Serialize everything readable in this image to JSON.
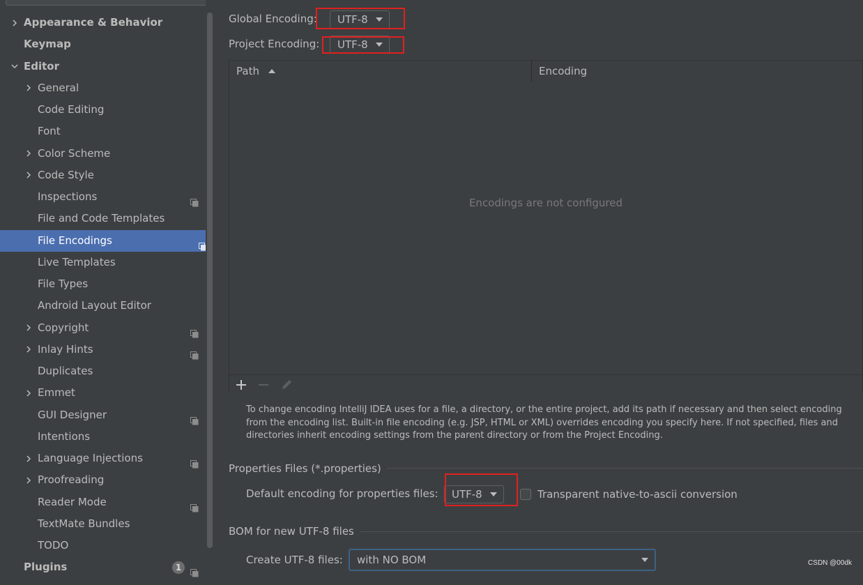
{
  "sidebar": {
    "items": [
      {
        "label": "Appearance & Behavior",
        "bold": true,
        "chevron": "right",
        "indent": 0
      },
      {
        "label": "Keymap",
        "bold": true,
        "chevron": "none",
        "indent": 0
      },
      {
        "label": "Editor",
        "bold": true,
        "chevron": "down",
        "indent": 0
      },
      {
        "label": "General",
        "chevron": "right",
        "indent": 1
      },
      {
        "label": "Code Editing",
        "chevron": "none",
        "indent": 1
      },
      {
        "label": "Font",
        "chevron": "none",
        "indent": 1
      },
      {
        "label": "Color Scheme",
        "chevron": "right",
        "indent": 1
      },
      {
        "label": "Code Style",
        "chevron": "right",
        "indent": 1
      },
      {
        "label": "Inspections",
        "chevron": "none",
        "indent": 1,
        "project_icon": true
      },
      {
        "label": "File and Code Templates",
        "chevron": "none",
        "indent": 1
      },
      {
        "label": "File Encodings",
        "chevron": "none",
        "indent": 1,
        "project_icon": true,
        "selected": true
      },
      {
        "label": "Live Templates",
        "chevron": "none",
        "indent": 1
      },
      {
        "label": "File Types",
        "chevron": "none",
        "indent": 1
      },
      {
        "label": "Android Layout Editor",
        "chevron": "none",
        "indent": 1
      },
      {
        "label": "Copyright",
        "chevron": "right",
        "indent": 1,
        "project_icon": true
      },
      {
        "label": "Inlay Hints",
        "chevron": "right",
        "indent": 1,
        "project_icon": true
      },
      {
        "label": "Duplicates",
        "chevron": "none",
        "indent": 1
      },
      {
        "label": "Emmet",
        "chevron": "right",
        "indent": 1
      },
      {
        "label": "GUI Designer",
        "chevron": "none",
        "indent": 1,
        "project_icon": true
      },
      {
        "label": "Intentions",
        "chevron": "none",
        "indent": 1
      },
      {
        "label": "Language Injections",
        "chevron": "right",
        "indent": 1,
        "project_icon": true
      },
      {
        "label": "Proofreading",
        "chevron": "right",
        "indent": 1
      },
      {
        "label": "Reader Mode",
        "chevron": "none",
        "indent": 1,
        "project_icon": true
      },
      {
        "label": "TextMate Bundles",
        "chevron": "none",
        "indent": 1
      },
      {
        "label": "TODO",
        "chevron": "none",
        "indent": 1
      },
      {
        "label": "Plugins",
        "bold": true,
        "chevron": "none",
        "indent": 0,
        "badge": "1",
        "project_icon": true
      }
    ]
  },
  "main": {
    "global_encoding": {
      "label": "Global Encoding:",
      "value": "UTF-8"
    },
    "project_encoding": {
      "label": "Project Encoding:",
      "value": "UTF-8"
    },
    "table": {
      "columns": [
        "Path",
        "Encoding"
      ],
      "sort_column": "Path",
      "empty_text": "Encodings are not configured",
      "toolbar": [
        "add-icon",
        "remove-icon",
        "edit-icon"
      ]
    },
    "help_text": "To change encoding IntelliJ IDEA uses for a file, a directory, or the entire project, add its path if necessary and then select encoding from the encoding list. Built-in file encoding (e.g. JSP, HTML or XML) overrides encoding you specify here. If not specified, files and directories inherit encoding settings from the parent directory or from the Project Encoding.",
    "properties_section": {
      "title": "Properties Files (*.properties)",
      "default_label": "Default encoding for properties files:",
      "default_value": "UTF-8",
      "checkbox_label": "Transparent native-to-ascii conversion",
      "checkbox_checked": false
    },
    "bom_section": {
      "title": "BOM for new UTF-8 files",
      "create_label": "Create UTF-8 files:",
      "create_value": "with NO BOM"
    }
  },
  "watermark": "CSDN @00dk",
  "colors": {
    "background": "#3c3f41",
    "selection": "#4b6eaf",
    "text": "#bbbbbb",
    "highlight_box": "#e02020",
    "focus_border": "#3d6185"
  }
}
